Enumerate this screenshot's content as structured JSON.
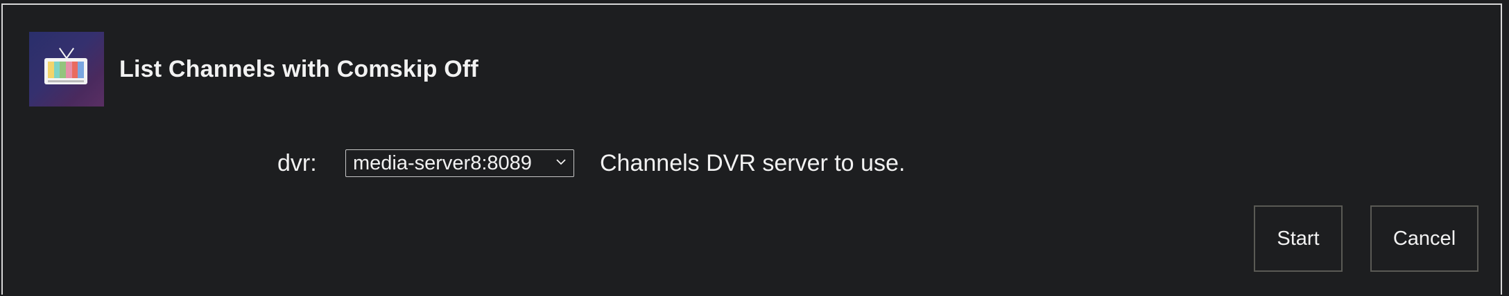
{
  "dialog": {
    "title": "List Channels with Comskip Off",
    "icon": "tv-icon"
  },
  "fields": {
    "dvr": {
      "label": "dvr:",
      "value": "media-server8:8089",
      "help": "Channels DVR server to use."
    }
  },
  "actions": {
    "start_label": "Start",
    "cancel_label": "Cancel"
  },
  "colors": {
    "background": "#1d1e20",
    "text": "#f2f2f2",
    "border": "#d8d8d8"
  }
}
